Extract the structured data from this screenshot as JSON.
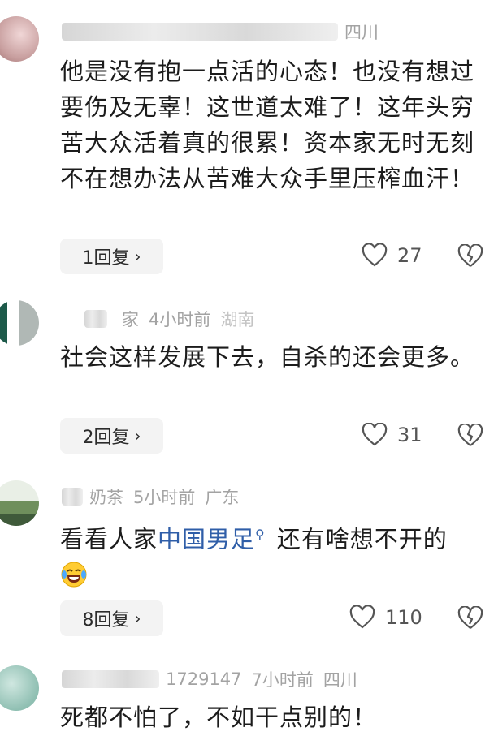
{
  "comments": [
    {
      "location": "四川",
      "text": "他是没有抱一点活的心态！也没有想过要伤及无辜！这世道太难了！这年头穷苦大众活着真的很累！资本家无时无刻不在想办法从苦难大众手里压榨血汗！",
      "reply_label": "1回复",
      "likes": "27"
    },
    {
      "name_fragment": "家",
      "time": "4小时前",
      "location": "湖南",
      "text": "社会这样发展下去，自杀的还会更多。",
      "reply_label": "2回复",
      "likes": "31"
    },
    {
      "name_fragment": "奶茶",
      "time": "5小时前",
      "location": "广东",
      "text_before": "看看人家",
      "link_text": "中国男足",
      "text_after": "还有啥想不开的",
      "emoji": "laughing-tears-emoji",
      "reply_label": "8回复",
      "likes": "110"
    },
    {
      "name_fragment": "1729147",
      "time": "7小时前",
      "location": "四川",
      "text": "死都不怕了，不如干点别的！"
    }
  ],
  "icons": {
    "like": "heart-outline-icon",
    "dislike": "broken-heart-icon",
    "reply_chevron": "›"
  },
  "colors": {
    "link": "#2f5ea8",
    "text": "#1c1c1c",
    "meta": "#a3a3a3",
    "reply_bg": "#f3f3f3"
  }
}
